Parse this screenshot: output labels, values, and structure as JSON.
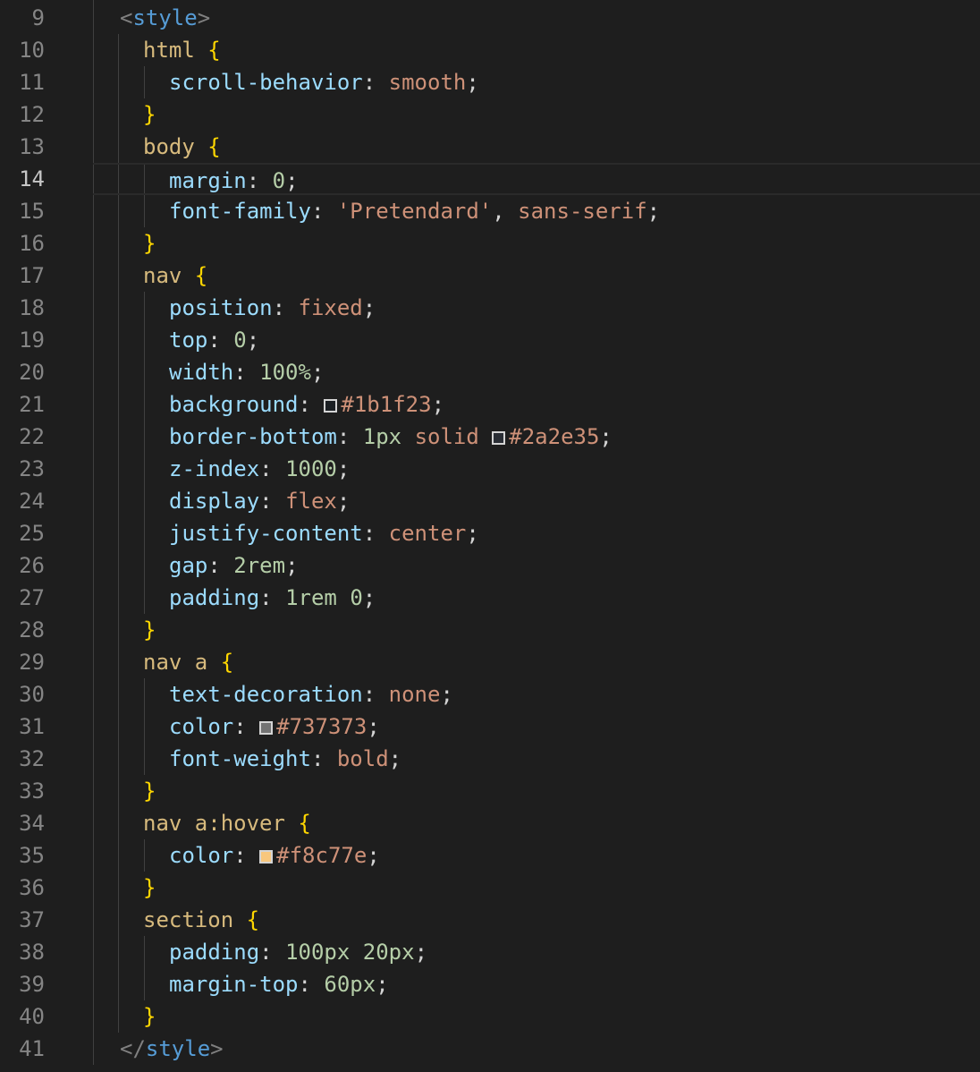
{
  "editor": {
    "language": "css",
    "active_line": 14,
    "lines": [
      {
        "no": "9",
        "indent": 0,
        "tokens": [
          {
            "t": "<",
            "c": "bracket"
          },
          {
            "t": "style",
            "c": "tag"
          },
          {
            "t": ">",
            "c": "bracket"
          }
        ]
      },
      {
        "no": "10",
        "indent": 1,
        "tokens": [
          {
            "t": "html ",
            "c": "sel"
          },
          {
            "t": "{",
            "c": "brace"
          }
        ]
      },
      {
        "no": "11",
        "indent": 2,
        "tokens": [
          {
            "t": "scroll-behavior",
            "c": "prop"
          },
          {
            "t": ": ",
            "c": "punct"
          },
          {
            "t": "smooth",
            "c": "val"
          },
          {
            "t": ";",
            "c": "punct"
          }
        ]
      },
      {
        "no": "12",
        "indent": 1,
        "tokens": [
          {
            "t": "}",
            "c": "brace"
          }
        ]
      },
      {
        "no": "13",
        "indent": 1,
        "tokens": [
          {
            "t": "body ",
            "c": "sel"
          },
          {
            "t": "{",
            "c": "brace"
          }
        ]
      },
      {
        "no": "14",
        "indent": 2,
        "tokens": [
          {
            "t": "margin",
            "c": "prop"
          },
          {
            "t": ": ",
            "c": "punct"
          },
          {
            "t": "0",
            "c": "num"
          },
          {
            "t": ";",
            "c": "punct"
          }
        ]
      },
      {
        "no": "15",
        "indent": 2,
        "tokens": [
          {
            "t": "font-family",
            "c": "prop"
          },
          {
            "t": ": ",
            "c": "punct"
          },
          {
            "t": "'Pretendard'",
            "c": "str"
          },
          {
            "t": ", ",
            "c": "punct"
          },
          {
            "t": "sans-serif",
            "c": "val"
          },
          {
            "t": ";",
            "c": "punct"
          }
        ]
      },
      {
        "no": "16",
        "indent": 1,
        "tokens": [
          {
            "t": "}",
            "c": "brace"
          }
        ]
      },
      {
        "no": "17",
        "indent": 1,
        "tokens": [
          {
            "t": "nav ",
            "c": "sel"
          },
          {
            "t": "{",
            "c": "brace"
          }
        ]
      },
      {
        "no": "18",
        "indent": 2,
        "tokens": [
          {
            "t": "position",
            "c": "prop"
          },
          {
            "t": ": ",
            "c": "punct"
          },
          {
            "t": "fixed",
            "c": "val"
          },
          {
            "t": ";",
            "c": "punct"
          }
        ]
      },
      {
        "no": "19",
        "indent": 2,
        "tokens": [
          {
            "t": "top",
            "c": "prop"
          },
          {
            "t": ": ",
            "c": "punct"
          },
          {
            "t": "0",
            "c": "num"
          },
          {
            "t": ";",
            "c": "punct"
          }
        ]
      },
      {
        "no": "20",
        "indent": 2,
        "tokens": [
          {
            "t": "width",
            "c": "prop"
          },
          {
            "t": ": ",
            "c": "punct"
          },
          {
            "t": "100%",
            "c": "num"
          },
          {
            "t": ";",
            "c": "punct"
          }
        ]
      },
      {
        "no": "21",
        "indent": 2,
        "tokens": [
          {
            "t": "background",
            "c": "prop"
          },
          {
            "t": ": ",
            "c": "punct"
          },
          {
            "t": "#1b1f23",
            "c": "val",
            "swatch": "#1b1f23"
          },
          {
            "t": ";",
            "c": "punct"
          }
        ]
      },
      {
        "no": "22",
        "indent": 2,
        "tokens": [
          {
            "t": "border-bottom",
            "c": "prop"
          },
          {
            "t": ": ",
            "c": "punct"
          },
          {
            "t": "1px",
            "c": "num"
          },
          {
            "t": " ",
            "c": "punct"
          },
          {
            "t": "solid",
            "c": "val"
          },
          {
            "t": " ",
            "c": "punct"
          },
          {
            "t": "#2a2e35",
            "c": "val",
            "swatch": "#2a2e35"
          },
          {
            "t": ";",
            "c": "punct"
          }
        ]
      },
      {
        "no": "23",
        "indent": 2,
        "tokens": [
          {
            "t": "z-index",
            "c": "prop"
          },
          {
            "t": ": ",
            "c": "punct"
          },
          {
            "t": "1000",
            "c": "num"
          },
          {
            "t": ";",
            "c": "punct"
          }
        ]
      },
      {
        "no": "24",
        "indent": 2,
        "tokens": [
          {
            "t": "display",
            "c": "prop"
          },
          {
            "t": ": ",
            "c": "punct"
          },
          {
            "t": "flex",
            "c": "val"
          },
          {
            "t": ";",
            "c": "punct"
          }
        ]
      },
      {
        "no": "25",
        "indent": 2,
        "tokens": [
          {
            "t": "justify-content",
            "c": "prop"
          },
          {
            "t": ": ",
            "c": "punct"
          },
          {
            "t": "center",
            "c": "val"
          },
          {
            "t": ";",
            "c": "punct"
          }
        ]
      },
      {
        "no": "26",
        "indent": 2,
        "tokens": [
          {
            "t": "gap",
            "c": "prop"
          },
          {
            "t": ": ",
            "c": "punct"
          },
          {
            "t": "2rem",
            "c": "num"
          },
          {
            "t": ";",
            "c": "punct"
          }
        ]
      },
      {
        "no": "27",
        "indent": 2,
        "tokens": [
          {
            "t": "padding",
            "c": "prop"
          },
          {
            "t": ": ",
            "c": "punct"
          },
          {
            "t": "1rem",
            "c": "num"
          },
          {
            "t": " ",
            "c": "punct"
          },
          {
            "t": "0",
            "c": "num"
          },
          {
            "t": ";",
            "c": "punct"
          }
        ]
      },
      {
        "no": "28",
        "indent": 1,
        "tokens": [
          {
            "t": "}",
            "c": "brace"
          }
        ]
      },
      {
        "no": "29",
        "indent": 1,
        "tokens": [
          {
            "t": "nav a ",
            "c": "sel"
          },
          {
            "t": "{",
            "c": "brace"
          }
        ]
      },
      {
        "no": "30",
        "indent": 2,
        "tokens": [
          {
            "t": "text-decoration",
            "c": "prop"
          },
          {
            "t": ": ",
            "c": "punct"
          },
          {
            "t": "none",
            "c": "val"
          },
          {
            "t": ";",
            "c": "punct"
          }
        ]
      },
      {
        "no": "31",
        "indent": 2,
        "tokens": [
          {
            "t": "color",
            "c": "prop"
          },
          {
            "t": ": ",
            "c": "punct"
          },
          {
            "t": "#737373",
            "c": "val",
            "swatch": "#737373"
          },
          {
            "t": ";",
            "c": "punct"
          }
        ]
      },
      {
        "no": "32",
        "indent": 2,
        "tokens": [
          {
            "t": "font-weight",
            "c": "prop"
          },
          {
            "t": ": ",
            "c": "punct"
          },
          {
            "t": "bold",
            "c": "val"
          },
          {
            "t": ";",
            "c": "punct"
          }
        ]
      },
      {
        "no": "33",
        "indent": 1,
        "tokens": [
          {
            "t": "}",
            "c": "brace"
          }
        ]
      },
      {
        "no": "34",
        "indent": 1,
        "tokens": [
          {
            "t": "nav a:hover ",
            "c": "sel"
          },
          {
            "t": "{",
            "c": "brace"
          }
        ]
      },
      {
        "no": "35",
        "indent": 2,
        "tokens": [
          {
            "t": "color",
            "c": "prop"
          },
          {
            "t": ": ",
            "c": "punct"
          },
          {
            "t": "#f8c77e",
            "c": "val",
            "swatch": "#f8c77e"
          },
          {
            "t": ";",
            "c": "punct"
          }
        ]
      },
      {
        "no": "36",
        "indent": 1,
        "tokens": [
          {
            "t": "}",
            "c": "brace"
          }
        ]
      },
      {
        "no": "37",
        "indent": 1,
        "tokens": [
          {
            "t": "section ",
            "c": "sel"
          },
          {
            "t": "{",
            "c": "brace"
          }
        ]
      },
      {
        "no": "38",
        "indent": 2,
        "tokens": [
          {
            "t": "padding",
            "c": "prop"
          },
          {
            "t": ": ",
            "c": "punct"
          },
          {
            "t": "100px",
            "c": "num"
          },
          {
            "t": " ",
            "c": "punct"
          },
          {
            "t": "20px",
            "c": "num"
          },
          {
            "t": ";",
            "c": "punct"
          }
        ]
      },
      {
        "no": "39",
        "indent": 2,
        "tokens": [
          {
            "t": "margin-top",
            "c": "prop"
          },
          {
            "t": ": ",
            "c": "punct"
          },
          {
            "t": "60px",
            "c": "num"
          },
          {
            "t": ";",
            "c": "punct"
          }
        ]
      },
      {
        "no": "40",
        "indent": 1,
        "tokens": [
          {
            "t": "}",
            "c": "brace"
          }
        ]
      },
      {
        "no": "41",
        "indent": 0,
        "tokens": [
          {
            "t": "</",
            "c": "bracket"
          },
          {
            "t": "style",
            "c": "tag"
          },
          {
            "t": ">",
            "c": "bracket"
          }
        ]
      }
    ]
  }
}
